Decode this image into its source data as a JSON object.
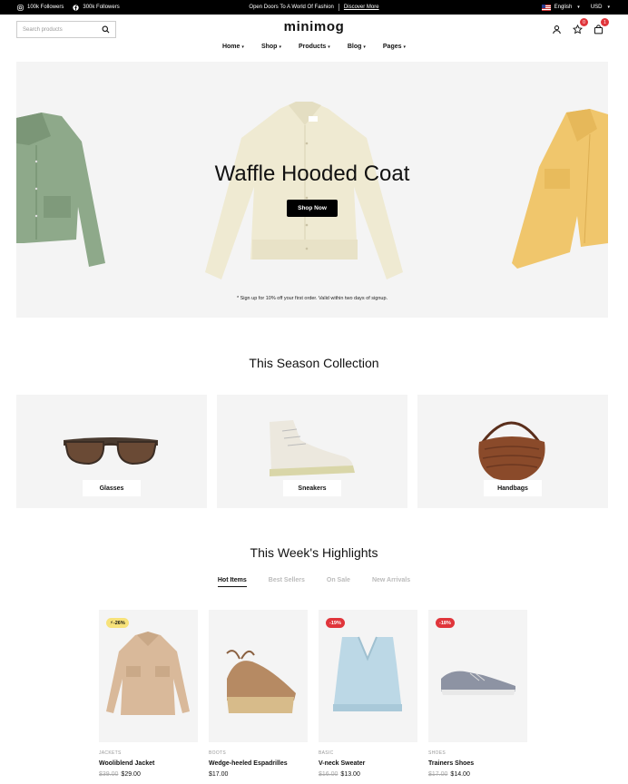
{
  "topbar": {
    "instagram": "100k Followers",
    "facebook": "300k Followers",
    "announcement": "Open Doors To A World Of Fashion",
    "announcement_link": "Discover More",
    "language": "English",
    "currency": "USD"
  },
  "header": {
    "search_placeholder": "Search products",
    "logo": "minimog",
    "wishlist_count": "0",
    "cart_count": "1"
  },
  "nav": [
    {
      "label": "Home"
    },
    {
      "label": "Shop"
    },
    {
      "label": "Products"
    },
    {
      "label": "Blog"
    },
    {
      "label": "Pages"
    }
  ],
  "hero": {
    "title": "Waffle Hooded Coat",
    "button": "Shop Now",
    "note": "* Sign up for 10% off your first order. Valid within two days of signup."
  },
  "collection": {
    "title": "This Season Collection",
    "items": [
      {
        "label": "Glasses"
      },
      {
        "label": "Sneakers"
      },
      {
        "label": "Handbags"
      }
    ]
  },
  "highlights": {
    "title": "This Week's Highlights",
    "tabs": [
      {
        "label": "Hot Items"
      },
      {
        "label": "Best Sellers"
      },
      {
        "label": "On Sale"
      },
      {
        "label": "New Arrivals"
      }
    ],
    "products": [
      {
        "badge": "-26%",
        "category": "JACKETS",
        "name": "Wooliblend Jacket",
        "old_price": "$39.00",
        "price": "$29.00"
      },
      {
        "badge": "",
        "category": "BOOTS",
        "name": "Wedge-heeled Espadrilles",
        "old_price": "",
        "price": "$17.00"
      },
      {
        "badge": "-19%",
        "category": "BASIC",
        "name": "V-neck Sweater",
        "old_price": "$16.00",
        "price": "$13.00"
      },
      {
        "badge": "-18%",
        "category": "SHOES",
        "name": "Trainers Shoes",
        "old_price": "$17.00",
        "price": "$14.00"
      }
    ]
  },
  "colors": {
    "accent_red": "#e0353b",
    "badge_yellow": "#f7e27a",
    "panel_gray": "#f4f4f4"
  }
}
